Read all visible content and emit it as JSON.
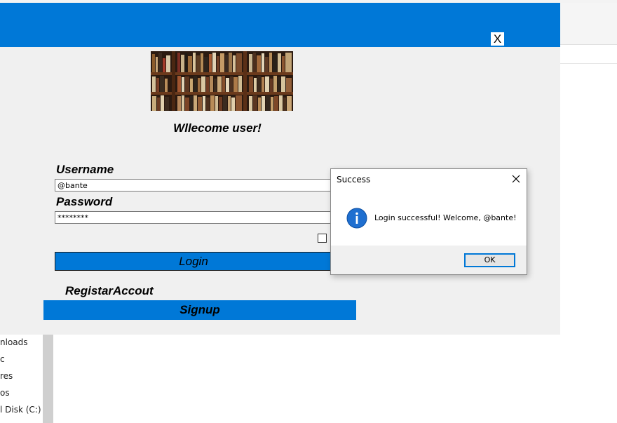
{
  "background_window": {
    "nav_items": [
      "nloads",
      "c",
      "res",
      "os",
      "l Disk (C:)"
    ]
  },
  "app": {
    "close_label": "X",
    "welcome_text": "Wllecome user!",
    "username_label": "Username",
    "username_value": "@bante",
    "password_label": "Password",
    "password_value": "********",
    "login_label": "Login",
    "register_label": "RegistarAccout",
    "signup_label": "Signup",
    "colors": {
      "header": "#0078d7",
      "button": "#0078d7",
      "background": "#f0f0f0"
    },
    "banner_image": "bookshelf"
  },
  "dialog": {
    "title": "Success",
    "message": "Login successful! Welcome, @bante!",
    "ok_label": "OK",
    "icon": "info-icon"
  }
}
